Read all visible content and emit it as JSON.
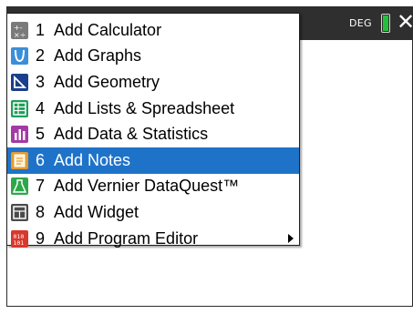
{
  "title_bar": {
    "angle_mode": "DEG",
    "battery_level": 0.85,
    "close_symbol": "✕"
  },
  "menu": {
    "items": [
      {
        "number": "1",
        "label": "Add Calculator",
        "icon": "calculator-icon"
      },
      {
        "number": "2",
        "label": "Add Graphs",
        "icon": "graphs-icon"
      },
      {
        "number": "3",
        "label": "Add Geometry",
        "icon": "geometry-icon"
      },
      {
        "number": "4",
        "label": "Add Lists & Spreadsheet",
        "icon": "spreadsheet-icon"
      },
      {
        "number": "5",
        "label": "Add Data & Statistics",
        "icon": "statistics-icon"
      },
      {
        "number": "6",
        "label": "Add Notes",
        "icon": "notes-icon",
        "selected": true
      },
      {
        "number": "7",
        "label": "Add Vernier DataQuest™",
        "icon": "dataquest-icon"
      },
      {
        "number": "8",
        "label": "Add Widget",
        "icon": "widget-icon"
      },
      {
        "number": "9",
        "label": "Add Program Editor",
        "icon": "program-editor-icon",
        "has_submenu": true
      }
    ]
  },
  "colors": {
    "selection": "#1e73c9",
    "title_bar": "#2f2f2f",
    "battery": "#25c03a"
  }
}
